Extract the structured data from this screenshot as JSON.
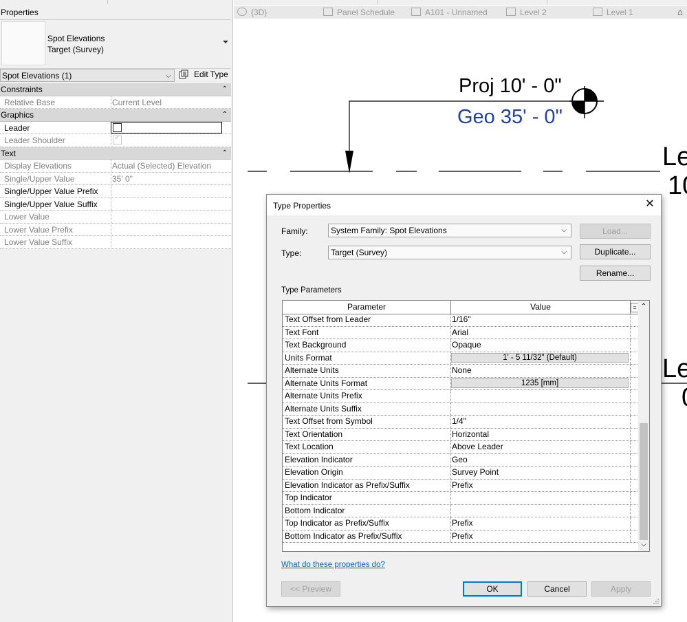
{
  "properties": {
    "title": "Properties",
    "type_name_line1": "Spot Elevations",
    "type_name_line2": "Target (Survey)",
    "instance_filter": "Spot Elevations (1)",
    "edit_type_label": "Edit Type",
    "groups": {
      "constraints": "Constraints",
      "graphics": "Graphics",
      "text": "Text"
    },
    "rows": {
      "relative_base": {
        "label": "Relative Base",
        "value": "Current Level"
      },
      "leader": {
        "label": "Leader"
      },
      "leader_shoulder": {
        "label": "Leader Shoulder"
      },
      "display_elevations": {
        "label": "Display Elevations",
        "value": "Actual (Selected) Elevation"
      },
      "single_upper_value": {
        "label": "Single/Upper Value",
        "value": "35'  0\""
      },
      "single_upper_prefix": {
        "label": "Single/Upper Value Prefix"
      },
      "single_upper_suffix": {
        "label": "Single/Upper Value Suffix"
      },
      "lower_value": {
        "label": "Lower Value"
      },
      "lower_prefix": {
        "label": "Lower Value Prefix"
      },
      "lower_suffix": {
        "label": "Lower Value Suffix"
      }
    }
  },
  "view_tabs": [
    "{3D}",
    "Panel Schedule",
    "A101 - Unnamed",
    "Level 2",
    "Level 1"
  ],
  "drawing": {
    "proj_label": "Proj 10' - 0\"",
    "geo_label": "Geo 35' - 0\"",
    "level_upper_1": "Le",
    "level_upper_2": "10",
    "level_lower_1": "Le",
    "level_lower_2": "0",
    "colors": {
      "geo": "#1f3fb0",
      "proj": "#000000"
    }
  },
  "dialog": {
    "title": "Type Properties",
    "family_label": "Family:",
    "family_value": "System Family: Spot Elevations",
    "type_label": "Type:",
    "type_value": "Target (Survey)",
    "load_button": "Load...",
    "duplicate_button": "Duplicate...",
    "rename_button": "Rename...",
    "type_parameters_label": "Type Parameters",
    "col_parameter": "Parameter",
    "col_value": "Value",
    "col_extra": "=",
    "params": [
      {
        "name": "Text Offset from Leader",
        "value": "1/16\""
      },
      {
        "name": "Text Font",
        "value": "Arial"
      },
      {
        "name": "Text Background",
        "value": "Opaque"
      },
      {
        "name": "Units Format",
        "value": "1' - 5 11/32\" (Default)",
        "button": true
      },
      {
        "name": "Alternate Units",
        "value": "None"
      },
      {
        "name": "Alternate Units Format",
        "value": "1235 [mm]",
        "button": true
      },
      {
        "name": "Alternate Units Prefix",
        "value": ""
      },
      {
        "name": "Alternate Units Suffix",
        "value": ""
      },
      {
        "name": "Text Offset from Symbol",
        "value": "1/4\""
      },
      {
        "name": "Text Orientation",
        "value": "Horizontal"
      },
      {
        "name": "Text Location",
        "value": "Above Leader"
      },
      {
        "name": "Elevation Indicator",
        "value": "Geo"
      },
      {
        "name": "Elevation Origin",
        "value": "Survey Point"
      },
      {
        "name": "Elevation Indicator as Prefix/Suffix",
        "value": "Prefix"
      },
      {
        "name": "Top Indicator",
        "value": ""
      },
      {
        "name": "Bottom Indicator",
        "value": ""
      },
      {
        "name": "Top Indicator as Prefix/Suffix",
        "value": "Prefix"
      },
      {
        "name": "Bottom Indicator as Prefix/Suffix",
        "value": "Prefix"
      }
    ],
    "help_link": "What do these properties do?",
    "preview_button": "<< Preview",
    "ok_button": "OK",
    "cancel_button": "Cancel",
    "apply_button": "Apply"
  }
}
